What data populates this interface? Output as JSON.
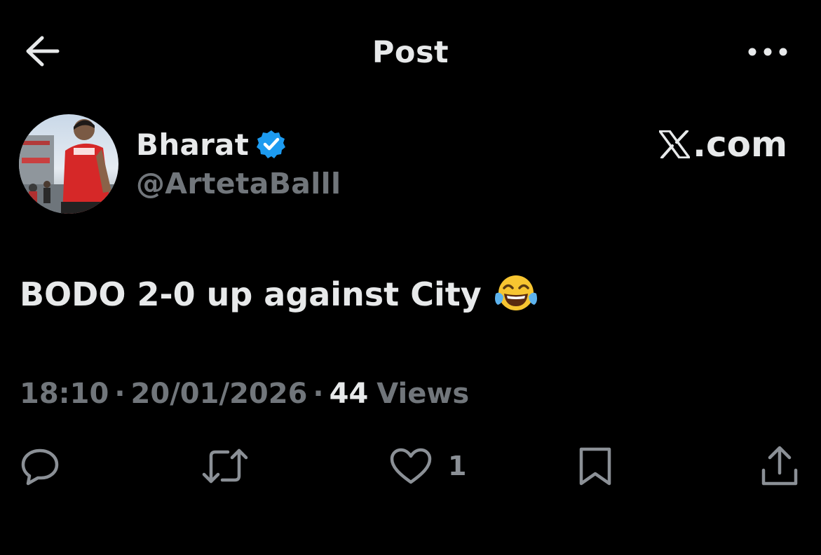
{
  "header": {
    "title": "Post",
    "back_icon": "arrow-left-icon",
    "more_icon": "more-horizontal-icon"
  },
  "author": {
    "display_name": "Bharat",
    "handle": "@ArtetaBalll",
    "verified": true,
    "verified_color": "#1d9bf0"
  },
  "watermark": {
    "logo_icon": "x-logo-icon",
    "text": ".com"
  },
  "tweet": {
    "text": "BODO 2-0 up against City",
    "emoji_icon": "face-with-tears-of-joy-emoji"
  },
  "meta": {
    "time": "18:10",
    "date": "20/01/2026",
    "views_count": "44",
    "views_label": "Views",
    "separator": "·"
  },
  "actions": {
    "reply_icon": "reply-bubble-icon",
    "retweet_icon": "retweet-icon",
    "like_icon": "heart-icon",
    "like_count": "1",
    "bookmark_icon": "bookmark-icon",
    "share_icon": "share-icon"
  },
  "colors": {
    "background": "#000000",
    "primary_text": "#e7e9ea",
    "secondary_text": "#71767b",
    "accent": "#1d9bf0"
  }
}
